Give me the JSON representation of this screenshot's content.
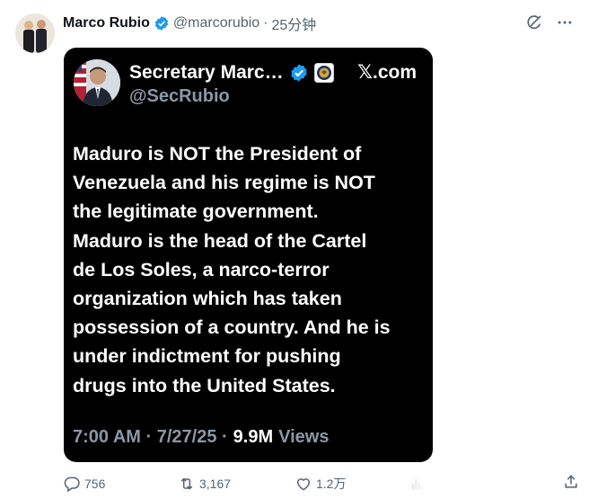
{
  "post": {
    "author_name": "Marco Rubio",
    "handle": "@marcorubio",
    "separator": "·",
    "time": "25分钟"
  },
  "quoted": {
    "author_name": "Secretary Marc…",
    "handle": "@SecRubio",
    "brand": "𝕏.com",
    "lines": [
      "Maduro is NOT the President of",
      "Venezuela and his regime is NOT",
      "the legitimate government.",
      "Maduro is the head of the Cartel",
      "de Los Soles, a narco-terror",
      "organization which has taken",
      "possession of a country.  And he is",
      "under indictment for pushing",
      "drugs into the United States."
    ],
    "timestamp": "7:00 AM · 7/27/25 ·",
    "views_count": "9.9M",
    "views_label": "Views"
  },
  "actions": {
    "replies": "756",
    "retweets": "3,167",
    "likes": "1.2万"
  },
  "icons": {
    "verified": "verified-badge-icon",
    "grok": "grok-icon",
    "more": "more-icon",
    "reply": "reply-icon",
    "retweet": "retweet-icon",
    "like": "heart-icon",
    "views": "views-icon",
    "share": "share-icon"
  },
  "colors": {
    "verified_blue": "#1d9bf0",
    "muted_text": "#536471",
    "card_bg": "#000000"
  }
}
